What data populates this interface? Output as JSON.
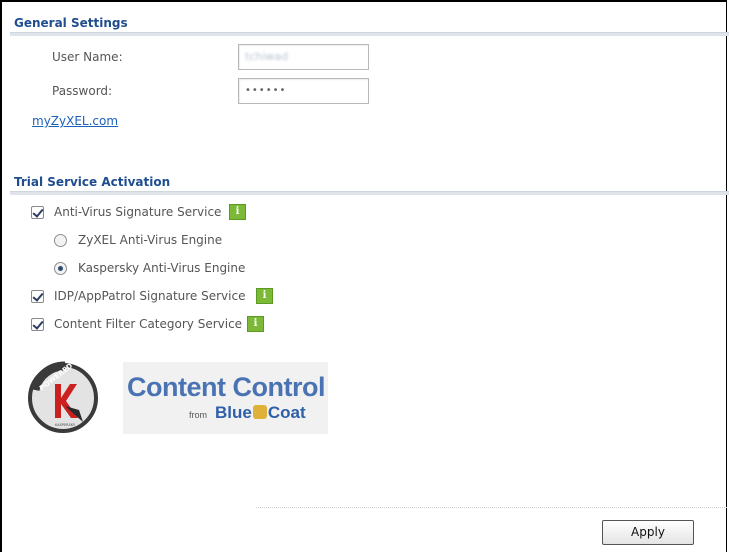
{
  "general_settings": {
    "title": "General Settings",
    "user_name_label": "User Name:",
    "user_name_value": "tchiwad",
    "password_label": "Password:",
    "password_value": "••••••",
    "link_label": "myZyXEL.com"
  },
  "trial_service": {
    "title": "Trial Service Activation",
    "items": [
      {
        "label": "Anti-Virus Signature Service",
        "checked": true,
        "info_icon": "info-icon",
        "info_glyph": "i"
      },
      {
        "label": "IDP/AppPatrol Signature Service",
        "checked": true,
        "info_icon": "info-icon",
        "info_glyph": "i"
      },
      {
        "label": "Content Filter Category Service",
        "checked": true,
        "info_icon": "info-icon",
        "info_glyph": "i"
      }
    ],
    "engines": [
      {
        "label": "ZyXEL Anti-Virus Engine",
        "selected": false
      },
      {
        "label": "Kaspersky Anti-Virus Engine",
        "selected": true
      }
    ]
  },
  "logos": {
    "kaspersky_badge_text": "POWERED BY",
    "kaspersky_small_text": "KASPERSKY",
    "content_control_title": "Content Control",
    "content_control_from": "from",
    "content_control_brand_1": "Blue",
    "content_control_brand_2": "Coat"
  },
  "footer": {
    "apply_label": "Apply"
  },
  "colors": {
    "section_title": "#1f4d8e",
    "link": "#1b62b8",
    "info_icon": "#7cb936",
    "brand_blue": "#4a73b4"
  }
}
